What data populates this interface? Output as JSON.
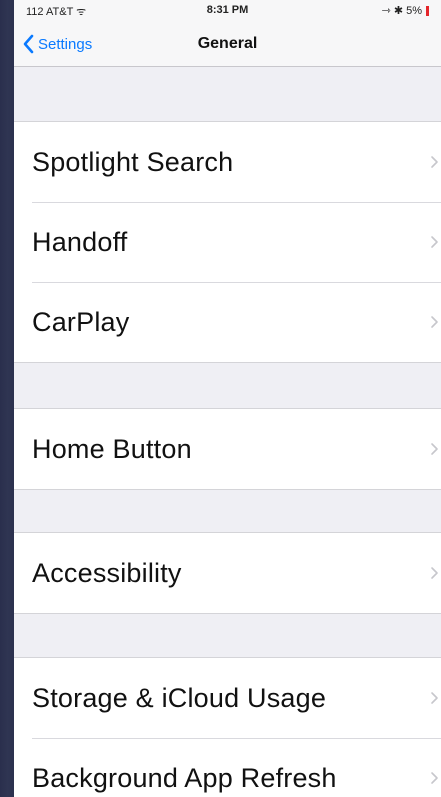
{
  "status_bar": {
    "carrier": "112 AT&T ᯤ",
    "time": "8:31 PM",
    "right": "⇾ ✱ 5%"
  },
  "nav": {
    "back_label": "Settings",
    "title": "General"
  },
  "groups": [
    {
      "items": [
        {
          "label": "Spotlight Search"
        },
        {
          "label": "Handoff"
        },
        {
          "label": "CarPlay"
        }
      ]
    },
    {
      "items": [
        {
          "label": "Home Button"
        }
      ]
    },
    {
      "items": [
        {
          "label": "Accessibility"
        }
      ]
    },
    {
      "items": [
        {
          "label": "Storage & iCloud Usage"
        },
        {
          "label": "Background App Refresh"
        }
      ]
    }
  ],
  "colors": {
    "accent": "#0a7aff",
    "background": "#efeff4",
    "battery_low": "#e4252a"
  },
  "icons": {
    "back": "chevron-left-icon",
    "disclosure": "chevron-right-icon"
  }
}
